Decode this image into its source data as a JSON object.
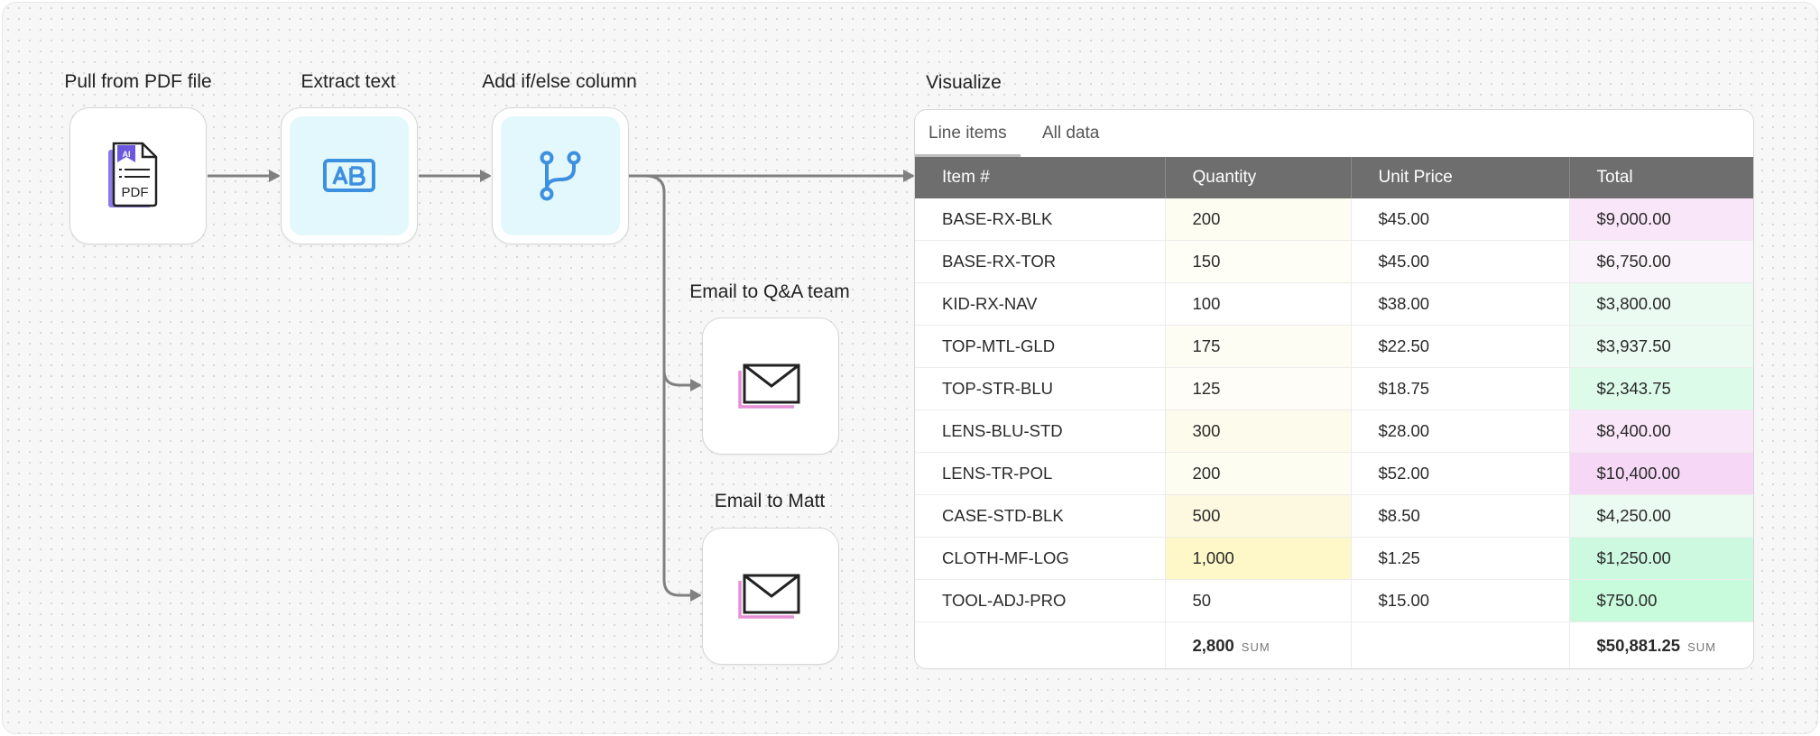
{
  "nodes": [
    {
      "label": "Pull from PDF file",
      "icon": "pdf-ai-icon"
    },
    {
      "label": "Extract text",
      "icon": "text-ab-icon"
    },
    {
      "label": "Add if/else column",
      "icon": "branch-icon"
    },
    {
      "label": "Email to Q&A team",
      "icon": "mail-icon"
    },
    {
      "label": "Email to Matt",
      "icon": "mail-icon"
    }
  ],
  "pdf_icon": {
    "badge": "AI",
    "text": "PDF"
  },
  "visualize": {
    "title": "Visualize",
    "tabs": [
      "Line items",
      "All data"
    ],
    "columns": [
      "Item #",
      "Quantity",
      "Unit Price",
      "Total"
    ],
    "rows": [
      {
        "item": "BASE-RX-BLK",
        "qty": "200",
        "price": "$45.00",
        "total": "$9,000.00"
      },
      {
        "item": "BASE-RX-TOR",
        "qty": "150",
        "price": "$45.00",
        "total": "$6,750.00"
      },
      {
        "item": "KID-RX-NAV",
        "qty": "100",
        "price": "$38.00",
        "total": "$3,800.00"
      },
      {
        "item": "TOP-MTL-GLD",
        "qty": "175",
        "price": "$22.50",
        "total": "$3,937.50"
      },
      {
        "item": "TOP-STR-BLU",
        "qty": "125",
        "price": "$18.75",
        "total": "$2,343.75"
      },
      {
        "item": "LENS-BLU-STD",
        "qty": "300",
        "price": "$28.00",
        "total": "$8,400.00"
      },
      {
        "item": "LENS-TR-POL",
        "qty": "200",
        "price": "$52.00",
        "total": "$10,400.00"
      },
      {
        "item": "CASE-STD-BLK",
        "qty": "500",
        "price": "$8.50",
        "total": "$4,250.00"
      },
      {
        "item": "CLOTH-MF-LOG",
        "qty": "1,000",
        "price": "$1.25",
        "total": "$1,250.00"
      },
      {
        "item": "TOOL-ADJ-PRO",
        "qty": "50",
        "price": "$15.00",
        "total": "$750.00"
      }
    ],
    "qty_colors": [
      "#fefdf2",
      "#fefdf6",
      "#ffffff",
      "#fefdf4",
      "#fefdf7",
      "#fdfbeb",
      "#fefdf2",
      "#fdf9e1",
      "#fef8c8",
      "#ffffff"
    ],
    "total_colors": [
      "#f9e6f9",
      "#fbf3fb",
      "#ebfbf1",
      "#ebfbf1",
      "#dcfbe9",
      "#f9e6f9",
      "#f6d8f6",
      "#ecfbf2",
      "#cdf9e1",
      "#c8fadc"
    ],
    "sum": {
      "qty": "2,800",
      "total": "$50,881.25",
      "tag": "SUM"
    }
  },
  "colors": {
    "accent_blue": "#3d8fe0",
    "pink": "#e78fd6",
    "purple": "#8b7be8",
    "connector": "#808080"
  }
}
